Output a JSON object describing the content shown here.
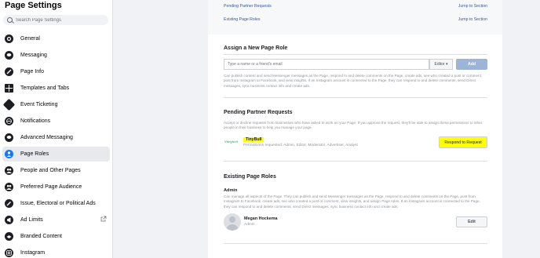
{
  "sidebar": {
    "title": "Page Settings",
    "search_placeholder": "Search Page Settings",
    "items": [
      {
        "label": "General",
        "icon": "gear-icon"
      },
      {
        "label": "Messaging",
        "icon": "chat-bubble-icon"
      },
      {
        "label": "Page Info",
        "icon": "pencil-icon"
      },
      {
        "label": "Templates and Tabs",
        "icon": "grid-icon"
      },
      {
        "label": "Event Ticketing",
        "icon": "ticket-icon"
      },
      {
        "label": "Notifications",
        "icon": "globe-icon"
      },
      {
        "label": "Advanced Messaging",
        "icon": "chat-bubble-icon"
      },
      {
        "label": "Page Roles",
        "icon": "person-icon",
        "active": true
      },
      {
        "label": "People and Other Pages",
        "icon": "people-icon"
      },
      {
        "label": "Preferred Page Audience",
        "icon": "people-icon"
      },
      {
        "label": "Issue, Electoral or Political Ads",
        "icon": "wrench-icon"
      },
      {
        "label": "Ad Limits",
        "icon": "megaphone-icon"
      },
      {
        "label": "Branded Content",
        "icon": "handshake-icon"
      },
      {
        "label": "Instagram",
        "icon": "instagram-icon"
      }
    ]
  },
  "top_links": [
    {
      "label": "Pending Partner Requests",
      "action": "Jump to Section"
    },
    {
      "label": "Existing Page Roles",
      "action": "Jump to Section"
    }
  ],
  "assign": {
    "title": "Assign a New Page Role",
    "input_placeholder": "Type a name or a friend's email",
    "role_dropdown": "Editor ▾",
    "add_button": "Add",
    "description": "Can publish content and send Messenger messages as the Page, respond to and delete comments on the Page, create ads, see who created a post or comment, post from Instagram to Facebook, and view insights. If an Instagram account is connected to the Page, they can respond to and delete comments, send Direct messages, sync business contact info and create ads."
  },
  "partner": {
    "title": "Pending Partner Requests",
    "description": "Accept or decline requests from businesses who have asked to work on your Page. If you approve the request, they'll be able to assign these permissions to other people in their business to help you manage your page.",
    "logo_text": "Vtinybull",
    "name": "TinyBull",
    "permissions": "Permissions requested: Admin, Editor, Moderator, Advertiser, Analyst",
    "respond_button": "Respond to Request"
  },
  "existing": {
    "title": "Existing Page Roles",
    "role_title": "Admin",
    "role_description": "Can manage all aspects of the Page. They can publish and send Messenger messages as the Page, respond to and delete comments on the Page, post from Instagram to Facebook, create ads, see who created a post or comment, view insights, and assign Page roles. If an Instagram account is connected to the Page, they can respond to and delete comments, send Direct messages, sync business contact info and create ads.",
    "person_name": "Megan Hockema",
    "person_role": "Admin",
    "edit_button": "Edit"
  },
  "colors": {
    "accent": "#1877f2",
    "link": "#385898",
    "highlight": "#ffff00",
    "add_button": "#9cb4d8"
  }
}
